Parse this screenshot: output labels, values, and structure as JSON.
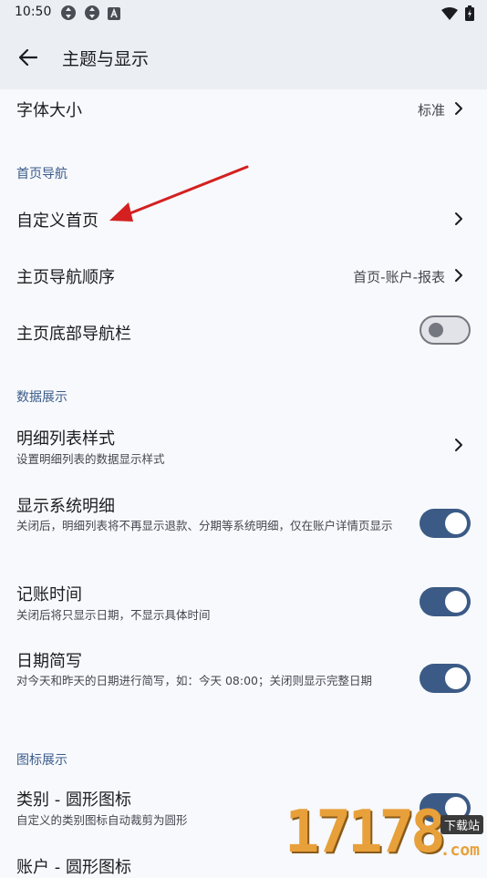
{
  "status_bar": {
    "time": "10:50",
    "icons": [
      "sync-icon",
      "sync-icon",
      "a-icon"
    ],
    "right_icons": [
      "wifi-icon",
      "battery-icon"
    ]
  },
  "app_bar": {
    "title": "主题与显示"
  },
  "rows": {
    "font_size": {
      "title": "字体大小",
      "value": "标准"
    },
    "custom_home": {
      "title": "自定义首页"
    },
    "home_nav_order": {
      "title": "主页导航顺序",
      "value": "首页-账户-报表"
    },
    "home_bottom_nav": {
      "title": "主页底部导航栏",
      "toggle": "off"
    },
    "detail_list_style": {
      "title": "明细列表样式",
      "subtitle": "设置明细列表的数据显示样式"
    },
    "show_system_detail": {
      "title": "显示系统明细",
      "subtitle": "关闭后，明细列表将不再显示退款、分期等系统明细，仅在账户详情页显示",
      "toggle": "on"
    },
    "record_time": {
      "title": "记账时间",
      "subtitle": "关闭后将只显示日期，不显示具体时间",
      "toggle": "on"
    },
    "date_short": {
      "title": "日期简写",
      "subtitle": "对今天和昨天的日期进行简写，如：今天 08:00；关闭则显示完整日期",
      "toggle": "on"
    },
    "category_round_icon": {
      "title": "类别 - 圆形图标",
      "subtitle": "自定义的类别图标自动裁剪为圆形",
      "toggle": "on"
    },
    "account_round_icon": {
      "title": "账户 - 圆形图标"
    }
  },
  "sections": {
    "home_nav": "首页导航",
    "data_display": "数据展示",
    "icon_display": "图标展示"
  },
  "watermark": {
    "digits": "17178",
    "tag": "下载站",
    "domain": ".com"
  },
  "colors": {
    "accent": "#3b5a86",
    "section_header": "#3b5b8a",
    "background": "#f7f9fc",
    "app_bar": "#ebeef3",
    "annotation_arrow": "#d42020"
  }
}
